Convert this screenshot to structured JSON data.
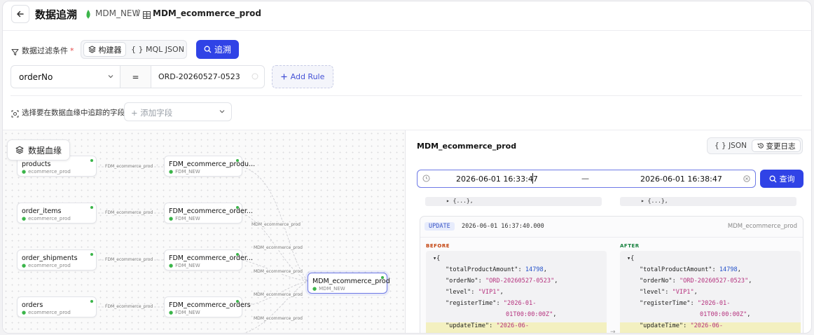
{
  "header": {
    "title": "数据追溯",
    "source_db": "MDM_NEW",
    "separator": "/",
    "target_table": "MDM_ecommerce_prod"
  },
  "filter": {
    "label": "数据过滤条件",
    "required_mark": "*",
    "mode_builder": "构建器",
    "mode_json": "{ } MQL JSON",
    "trace_button": "追溯",
    "rule": {
      "field": "orderNo",
      "operator": "=",
      "value": "ORD-20260527-0523"
    },
    "add_rule": "Add Rule"
  },
  "trace_fields": {
    "label": "选择要在数据血缘中追踪的字段",
    "placeholder": "+ 添加字段"
  },
  "lineage": {
    "badge": "数据血缘",
    "sources": [
      {
        "title": "products",
        "db": "ecommerce_prod"
      },
      {
        "title": "order_items",
        "db": "ecommerce_prod"
      },
      {
        "title": "order_shipments",
        "db": "ecommerce_prod"
      },
      {
        "title": "orders",
        "db": "ecommerce_prod"
      }
    ],
    "mid_edge_label": "FDM_ecommerce_prod",
    "fdm": [
      {
        "title": "FDM_ecommerce_produ...",
        "db": "FDM_NEW"
      },
      {
        "title": "FDM_ecommerce_order...",
        "db": "FDM_NEW"
      },
      {
        "title": "FDM_ecommerce_order...",
        "db": "FDM_NEW"
      },
      {
        "title": "FDM_ecommerce_orders",
        "db": "FDM_NEW"
      }
    ],
    "target_edge_label": "MDM_ecommerce_prod",
    "target": {
      "title": "MDM_ecommerce_prod",
      "db": "MDM_NEW"
    }
  },
  "panel": {
    "title": "MDM_ecommerce_prod",
    "json_tab": "{ } JSON",
    "log_tab": "变更日志",
    "range_start": "2026-06-01 16:33:47",
    "range_dash": "—",
    "range_end": "2026-06-01 16:38:47",
    "query_button": "查询",
    "collapsed_left": "▸ {...},",
    "collapsed_right": "▸ {...},",
    "entry": {
      "op": "UPDATE",
      "time": "2026-06-01 16:37:40.000",
      "source": "MDM_ecommerce_prod",
      "before_label": "BEFORE",
      "after_label": "AFTER",
      "open": "▾{",
      "k1": "\"totalProductAmount\"",
      "v1": "14798",
      "k2": "\"orderNo\"",
      "v2": "\"ORD-20260527-0523\"",
      "k3": "\"level\"",
      "v3": "\"VIP1\"",
      "k4": "\"registerTime\"",
      "v4a": "\"2026-01-",
      "v4b": "01T00:00:00Z\"",
      "k5": "\"updateTime\"",
      "v5": "\"2026-06-",
      "arrow": "→"
    }
  },
  "colors": {
    "primary": "#3043e6",
    "mongo_green": "#3bb54a",
    "update_bg": "#e7ecfc",
    "highlight": "#f3f0c0"
  }
}
